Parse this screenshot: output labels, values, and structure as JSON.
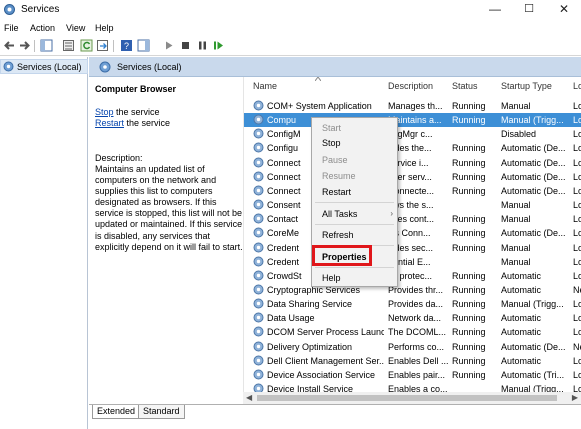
{
  "window": {
    "title": "Services",
    "minimize": "—",
    "maximize": "☐",
    "close": "✕"
  },
  "menu": [
    "File",
    "Action",
    "View",
    "Help"
  ],
  "tree": {
    "item": "Services (Local)"
  },
  "pane": {
    "header_title": "Services (Local)",
    "service_name": "Computer Browser",
    "stop_link": "Stop",
    "stop_suffix": " the service",
    "restart_link": "Restart",
    "restart_suffix": " the service",
    "description_label": "Description:",
    "description_text": "Maintains an updated list of computers on the network and supplies this list to computers designated as browsers. If this service is stopped, this list will not be updated or maintained. If this service is disabled, any services that explicitly depend on it will fail to start."
  },
  "columns": [
    "Name",
    "Description",
    "Status",
    "Startup Type",
    "Lo"
  ],
  "rows": [
    {
      "name": "COM+ System Application",
      "desc": "Manages th...",
      "status": "Running",
      "startup": "Manual",
      "log": "Lo"
    },
    {
      "name": "Compu",
      "desc": "Maintains a...",
      "status": "Running",
      "startup": "Manual (Trigg...",
      "log": "Lo"
    },
    {
      "name": "ConfigM",
      "desc": "nfigMgr c...",
      "status": "",
      "startup": "Disabled",
      "log": "Lo"
    },
    {
      "name": "Configu",
      "desc": "vides the...",
      "status": "Running",
      "startup": "Automatic (De...",
      "log": "Lo"
    },
    {
      "name": "Connect",
      "desc": "service i...",
      "status": "Running",
      "startup": "Automatic (De...",
      "log": "Lo"
    },
    {
      "name": "Connect",
      "desc": "user serv...",
      "status": "Running",
      "startup": "Automatic (De...",
      "log": "Lo"
    },
    {
      "name": "Connect",
      "desc": "Connecte...",
      "status": "Running",
      "startup": "Automatic (De...",
      "log": "Lo"
    },
    {
      "name": "Consent",
      "desc": "ows the s...",
      "status": "",
      "startup": "Manual",
      "log": "Lo"
    },
    {
      "name": "Contact",
      "desc": "exes cont...",
      "status": "Running",
      "startup": "Manual",
      "log": "Lo"
    },
    {
      "name": "CoreMe",
      "desc": "ws Conn...",
      "status": "Running",
      "startup": "Automatic (De...",
      "log": "Lo"
    },
    {
      "name": "Credent",
      "desc": "vides sec...",
      "status": "Running",
      "startup": "Manual",
      "log": "Lo"
    },
    {
      "name": "Credent",
      "desc": "dential E...",
      "status": "",
      "startup": "Manual",
      "log": "Lo"
    },
    {
      "name": "CrowdSt",
      "desc": "ss protec...",
      "status": "Running",
      "startup": "Automatic",
      "log": "Lo"
    },
    {
      "name": "Cryptographic Services",
      "desc": "Provides thr...",
      "status": "Running",
      "startup": "Automatic",
      "log": "Ne"
    },
    {
      "name": "Data Sharing Service",
      "desc": "Provides da...",
      "status": "Running",
      "startup": "Manual (Trigg...",
      "log": "Lo"
    },
    {
      "name": "Data Usage",
      "desc": "Network da...",
      "status": "Running",
      "startup": "Automatic",
      "log": "Lo"
    },
    {
      "name": "DCOM Server Process Launc...",
      "desc": "The DCOML...",
      "status": "Running",
      "startup": "Automatic",
      "log": "Lo"
    },
    {
      "name": "Delivery Optimization",
      "desc": "Performs co...",
      "status": "Running",
      "startup": "Automatic (De...",
      "log": "Ne"
    },
    {
      "name": "Dell Client Management Ser...",
      "desc": "Enables Dell ...",
      "status": "Running",
      "startup": "Automatic",
      "log": "Lo"
    },
    {
      "name": "Device Association Service",
      "desc": "Enables pair...",
      "status": "Running",
      "startup": "Automatic (Tri...",
      "log": "Lo"
    },
    {
      "name": "Device Install Service",
      "desc": "Enables a co...",
      "status": "",
      "startup": "Manual (Trigg...",
      "log": "Lo"
    }
  ],
  "context_menu": {
    "start": "Start",
    "stop": "Stop",
    "pause": "Pause",
    "resume": "Resume",
    "restart": "Restart",
    "all_tasks": "All Tasks",
    "refresh": "Refresh",
    "properties": "Properties",
    "help": "Help"
  },
  "tabs": [
    "Extended",
    "Standard"
  ],
  "colors": {
    "selection": "#3d8fd6",
    "highlight": "#e0161a",
    "link": "#0645ad"
  }
}
